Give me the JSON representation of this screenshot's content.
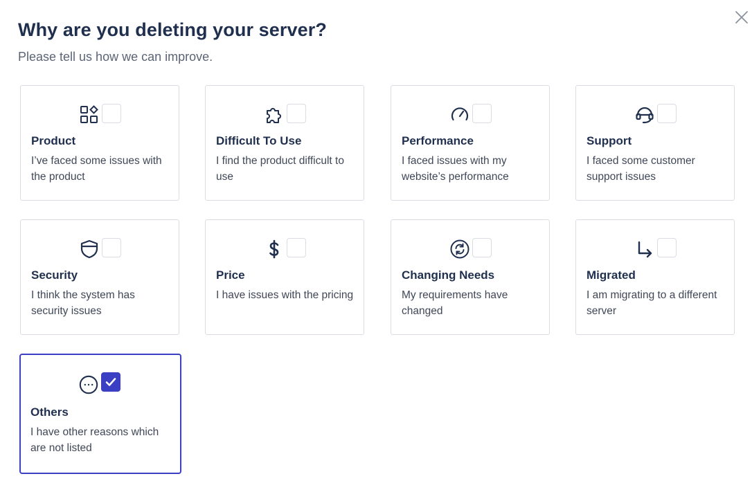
{
  "dialog": {
    "title": "Why are you deleting your server?",
    "subtitle": "Please tell us how we can improve.",
    "close_icon": "close-icon"
  },
  "colors": {
    "accent": "#3a3fc4",
    "text_dark": "#1f2f4d",
    "border": "#d9dce3"
  },
  "options": [
    {
      "title": "Product",
      "description": "I’ve faced some issues with the product",
      "icon": "widgets-icon",
      "checked": false
    },
    {
      "title": "Difficult To Use",
      "description": "I find the product difficult to use",
      "icon": "puzzle-icon",
      "checked": false
    },
    {
      "title": "Performance",
      "description": "I faced issues with my website’s performance",
      "icon": "speedometer-icon",
      "checked": false
    },
    {
      "title": "Support",
      "description": "I faced some customer support issues",
      "icon": "headset-icon",
      "checked": false
    },
    {
      "title": "Security",
      "description": "I think the system has security issues",
      "icon": "shield-icon",
      "checked": false
    },
    {
      "title": "Price",
      "description": "I have issues with the pricing",
      "icon": "dollar-icon",
      "checked": false
    },
    {
      "title": "Changing Needs",
      "description": "My requirements have changed",
      "icon": "refresh-circle-icon",
      "checked": false
    },
    {
      "title": "Migrated",
      "description": "I am migrating to a different server",
      "icon": "arrow-turn-right-icon",
      "checked": false
    },
    {
      "title": "Others",
      "description": "I have other reasons which are not listed",
      "icon": "more-horizontal-icon",
      "checked": true
    }
  ]
}
